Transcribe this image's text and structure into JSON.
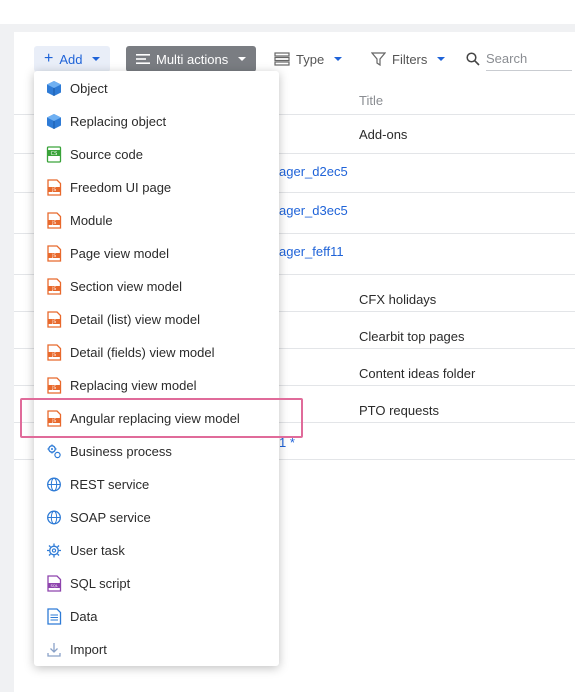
{
  "toolbar": {
    "add_label": "Add",
    "multi_label": "Multi actions",
    "type_label": "Type",
    "filters_label": "Filters",
    "search_placeholder": "Search"
  },
  "grid": {
    "title_header": "Title",
    "rows": [
      {
        "name": "",
        "title": "Add-ons"
      },
      {
        "name": "ager_d2ec5",
        "title": ""
      },
      {
        "name": "ager_d3ec5",
        "title": ""
      },
      {
        "name": "ager_feff11",
        "title": ""
      },
      {
        "name": "",
        "title": "CFX holidays"
      },
      {
        "name": "",
        "title": "Clearbit top pages"
      },
      {
        "name": "",
        "title": "Content ideas folder"
      },
      {
        "name": "",
        "title": "PTO requests"
      },
      {
        "name": "1 *",
        "title": ""
      }
    ]
  },
  "add_menu": {
    "items": [
      {
        "label": "Object",
        "icon": "object-icon"
      },
      {
        "label": "Replacing object",
        "icon": "object-icon"
      },
      {
        "label": "Source code",
        "icon": "source-code-icon"
      },
      {
        "label": "Freedom UI page",
        "icon": "js-file-icon"
      },
      {
        "label": "Module",
        "icon": "js-file-icon"
      },
      {
        "label": "Page view model",
        "icon": "js-file-icon"
      },
      {
        "label": "Section view model",
        "icon": "js-file-icon"
      },
      {
        "label": "Detail (list) view model",
        "icon": "js-file-icon"
      },
      {
        "label": "Detail (fields) view model",
        "icon": "js-file-icon"
      },
      {
        "label": "Replacing view model",
        "icon": "js-file-icon"
      },
      {
        "label": "Angular replacing view model",
        "icon": "js-file-icon"
      },
      {
        "label": "Business process",
        "icon": "business-process-icon"
      },
      {
        "label": "REST service",
        "icon": "globe-icon"
      },
      {
        "label": "SOAP service",
        "icon": "globe-icon"
      },
      {
        "label": "User task",
        "icon": "gear-icon"
      },
      {
        "label": "SQL script",
        "icon": "sql-file-icon"
      },
      {
        "label": "Data",
        "icon": "data-file-icon"
      },
      {
        "label": "Import",
        "icon": "import-icon"
      }
    ]
  },
  "colors": {
    "accent": "#1f63d8",
    "multi_button": "#7a7d82",
    "highlight": "#e06b9a",
    "js_file": "#e8692c",
    "source_code": "#3aa33a",
    "sql_file": "#8e44ad"
  }
}
